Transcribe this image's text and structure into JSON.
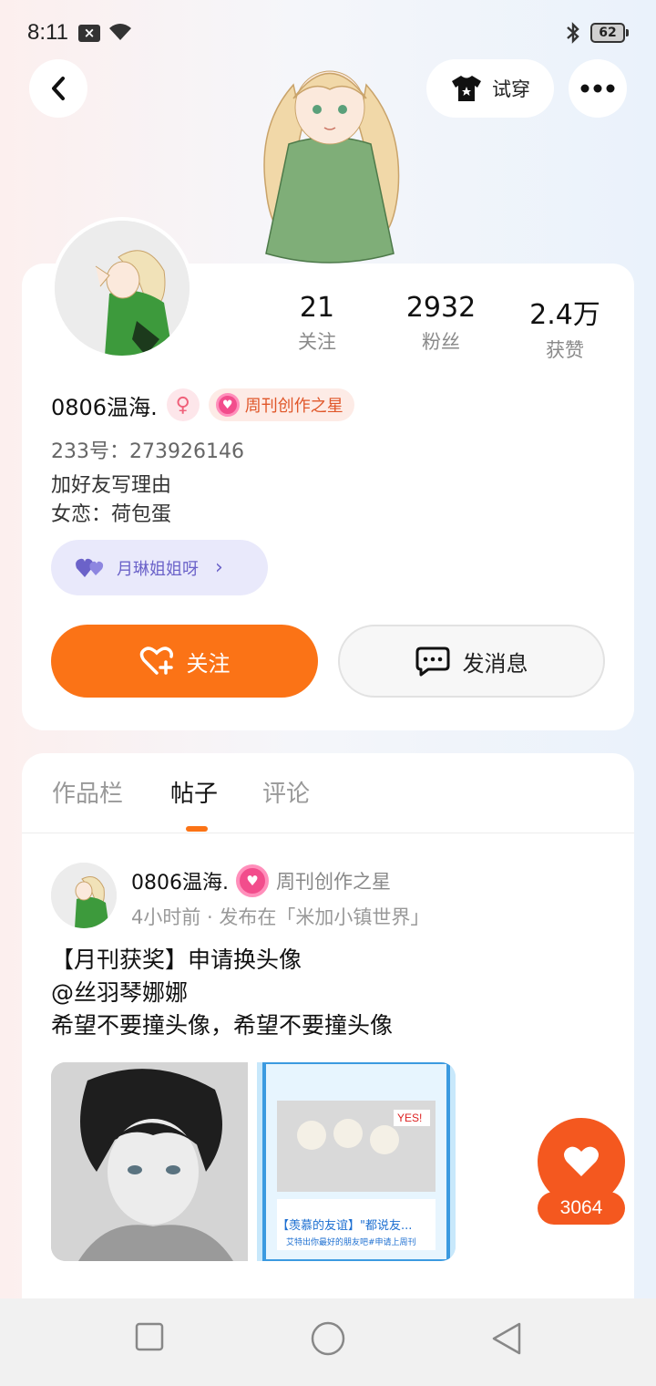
{
  "status_bar": {
    "time": "8:11",
    "notification_icon": "x-icon",
    "battery": "62"
  },
  "header": {
    "tryon_label": "试穿"
  },
  "profile": {
    "stats": [
      {
        "value": "21",
        "label": "关注"
      },
      {
        "value": "2932",
        "label": "粉丝"
      },
      {
        "value": "2.4万",
        "label": "获赞"
      }
    ],
    "username": "0806温海.",
    "badge_label": "周刊创作之星",
    "uid": "233号：273926146",
    "bio_lines": [
      "加好友写理由",
      "女恋：荷包蛋"
    ],
    "relation_label": "月琳姐姐呀",
    "follow_label": "关注",
    "message_label": "发消息"
  },
  "tabs": [
    {
      "label": "作品栏",
      "active": false
    },
    {
      "label": "帖子",
      "active": true
    },
    {
      "label": "评论",
      "active": false
    }
  ],
  "post": {
    "username": "0806温海.",
    "badge_label": "周刊创作之星",
    "meta": "4小时前 · 发布在「米加小镇世界」",
    "lines": [
      "【月刊获奖】申请换头像",
      "@丝羽琴娜娜",
      "希望不要撞头像，希望不要撞头像"
    ],
    "image2_caption": "【羡慕的友谊】\"都说友...",
    "image2_subcaption": "艾特出你最好的朋友吧#申请上周刊"
  },
  "like": {
    "count": "3064"
  },
  "colors": {
    "accent": "#fb7316",
    "like": "#f4581f",
    "relation": "#6b62c9"
  }
}
